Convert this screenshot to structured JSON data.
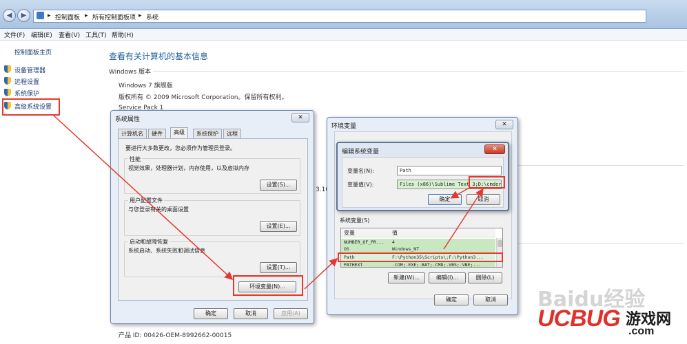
{
  "address_bar": {
    "crumbs": [
      "控制面板",
      "所有控制面板项",
      "系统"
    ]
  },
  "menubar": {
    "items": [
      "文件(F)",
      "编辑(E)",
      "查看(V)",
      "工具(T)",
      "帮助(H)"
    ]
  },
  "left_pane": {
    "home": "控制面板主页",
    "links": [
      "设备管理器",
      "远程设置",
      "系统保护",
      "高级系统设置"
    ]
  },
  "main": {
    "title": "查看有关计算机的基本信息",
    "edition_heading": "Windows 版本",
    "edition": "Windows 7 旗舰版",
    "copyright": "版权所有 © 2009 Microsoft Corporation。保留所有权利。",
    "service_pack": "Service Pack 1",
    "partial_number": "3.10",
    "product_id": "产品 ID: 00426-OEM-8992662-00015"
  },
  "system_properties": {
    "title": "系统属性",
    "tabs": [
      "计算机名",
      "硬件",
      "高级",
      "系统保护",
      "远程"
    ],
    "intro": "要进行大多数更改，您必须作为管理员登录。",
    "performance": {
      "heading": "性能",
      "text": "视觉效果，处理器计划，内存使用，以及虚拟内存",
      "button": "设置(S)..."
    },
    "user_profiles": {
      "heading": "用户配置文件",
      "text": "与您登录有关的桌面设置",
      "button": "设置(E)..."
    },
    "startup": {
      "heading": "启动和故障恢复",
      "text": "系统启动、系统失败和调试信息",
      "button": "设置(T)..."
    },
    "env_button": "环境变量(N)...",
    "ok": "确定",
    "cancel": "取消",
    "apply": "应用(A)"
  },
  "env_vars": {
    "title": "环境变量",
    "system_vars_label": "系统变量(S)",
    "columns": [
      "变量",
      "值"
    ],
    "rows": [
      {
        "name": "NUMBER_OF_PR...",
        "value": "4"
      },
      {
        "name": "OS",
        "value": "Windows_NT"
      },
      {
        "name": "Path",
        "value": "F:\\Python35\\Scripts\\;F:\\Python3..."
      },
      {
        "name": "PATHEXT",
        "value": ".COM;.EXE;.BAT;.CMD;.VBS;.VBE;..."
      }
    ],
    "new_button": "新建(W)...",
    "edit_button": "编辑(I)...",
    "delete_button": "删除(L)",
    "ok": "确定",
    "cancel": "取消"
  },
  "edit_var": {
    "title": "编辑系统变量",
    "name_label": "变量名(N):",
    "name_value": "Path",
    "value_label": "变量值(V):",
    "value_value": "Files (x86)\\Sublime Text 3;D:\\cmder",
    "ok": "确定",
    "cancel": "取消"
  },
  "watermarks": {
    "baidu": "Baidu经验",
    "ucbug": "UCBUG",
    "ucbug_cn": "游戏网",
    "ucbug_com": ".com"
  },
  "colors": {
    "highlight": "#e5382f",
    "link": "#1f3f77",
    "title_blue": "#1d5b9e",
    "selected_row": "#c9e8c1"
  }
}
